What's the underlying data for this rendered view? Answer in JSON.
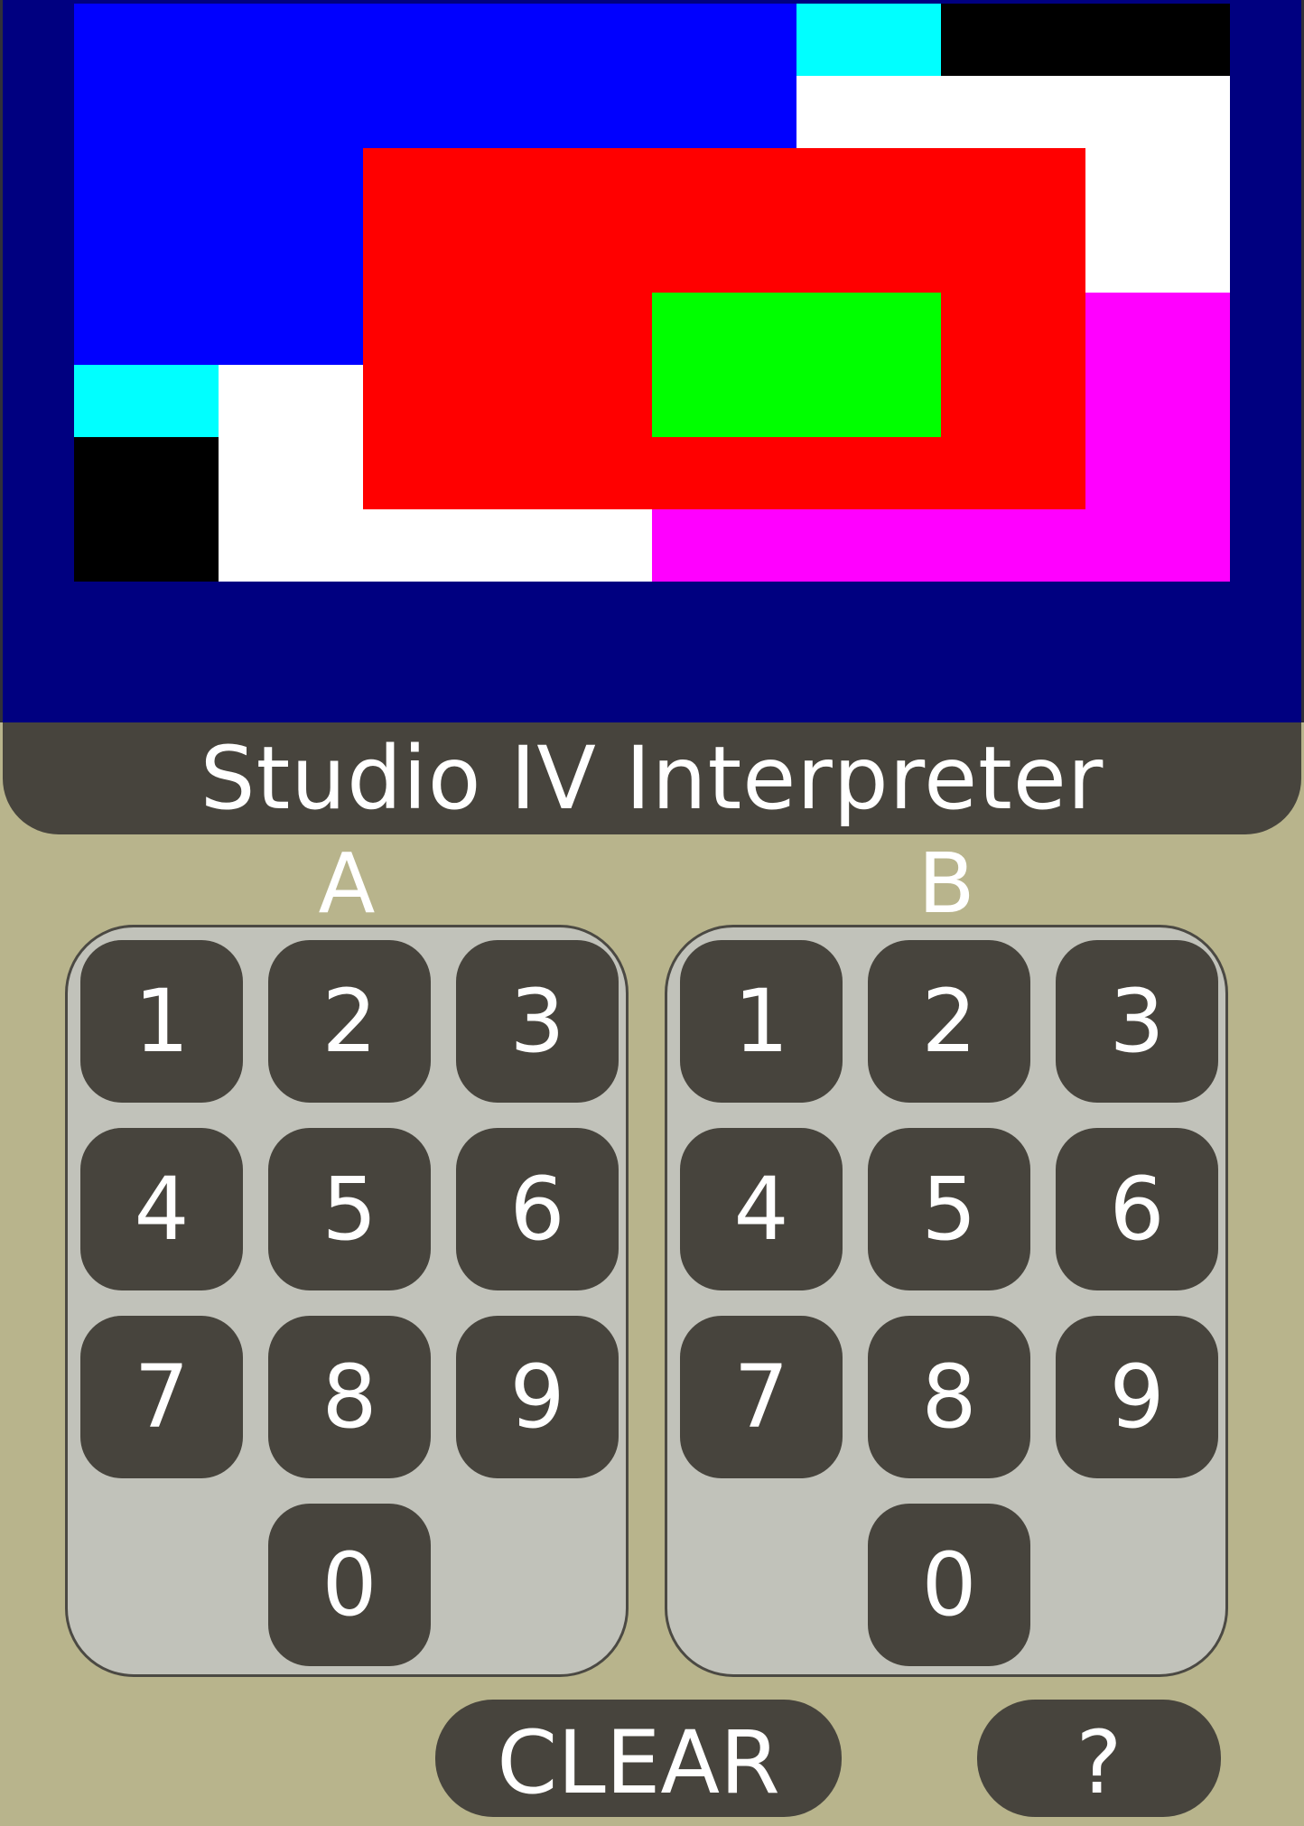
{
  "app": {
    "title": "Studio IV Interpreter"
  },
  "screen": {
    "background": "#000080",
    "blocks": [
      {
        "name": "blue-block",
        "color": "#0000ff"
      },
      {
        "name": "cyan-block-top",
        "color": "#00ffff"
      },
      {
        "name": "black-block-top",
        "color": "#000000"
      },
      {
        "name": "white-block-right",
        "color": "#ffffff"
      },
      {
        "name": "magenta-block",
        "color": "#ff00ff"
      },
      {
        "name": "cyan-block-left",
        "color": "#00ffff"
      },
      {
        "name": "black-block-left",
        "color": "#000000"
      },
      {
        "name": "white-block-bottom",
        "color": "#ffffff"
      },
      {
        "name": "red-block",
        "color": "#ff0000"
      },
      {
        "name": "green-block",
        "color": "#00ff00"
      }
    ]
  },
  "keypads": {
    "a": {
      "label": "A",
      "keys": [
        "1",
        "2",
        "3",
        "4",
        "5",
        "6",
        "7",
        "8",
        "9",
        "0"
      ]
    },
    "b": {
      "label": "B",
      "keys": [
        "1",
        "2",
        "3",
        "4",
        "5",
        "6",
        "7",
        "8",
        "9",
        "0"
      ]
    }
  },
  "actions": {
    "clear": "CLEAR",
    "help": "?"
  },
  "colors": {
    "panel": "#b8b48c",
    "button": "#47443d",
    "keypad_background": "#c1c2ba"
  }
}
